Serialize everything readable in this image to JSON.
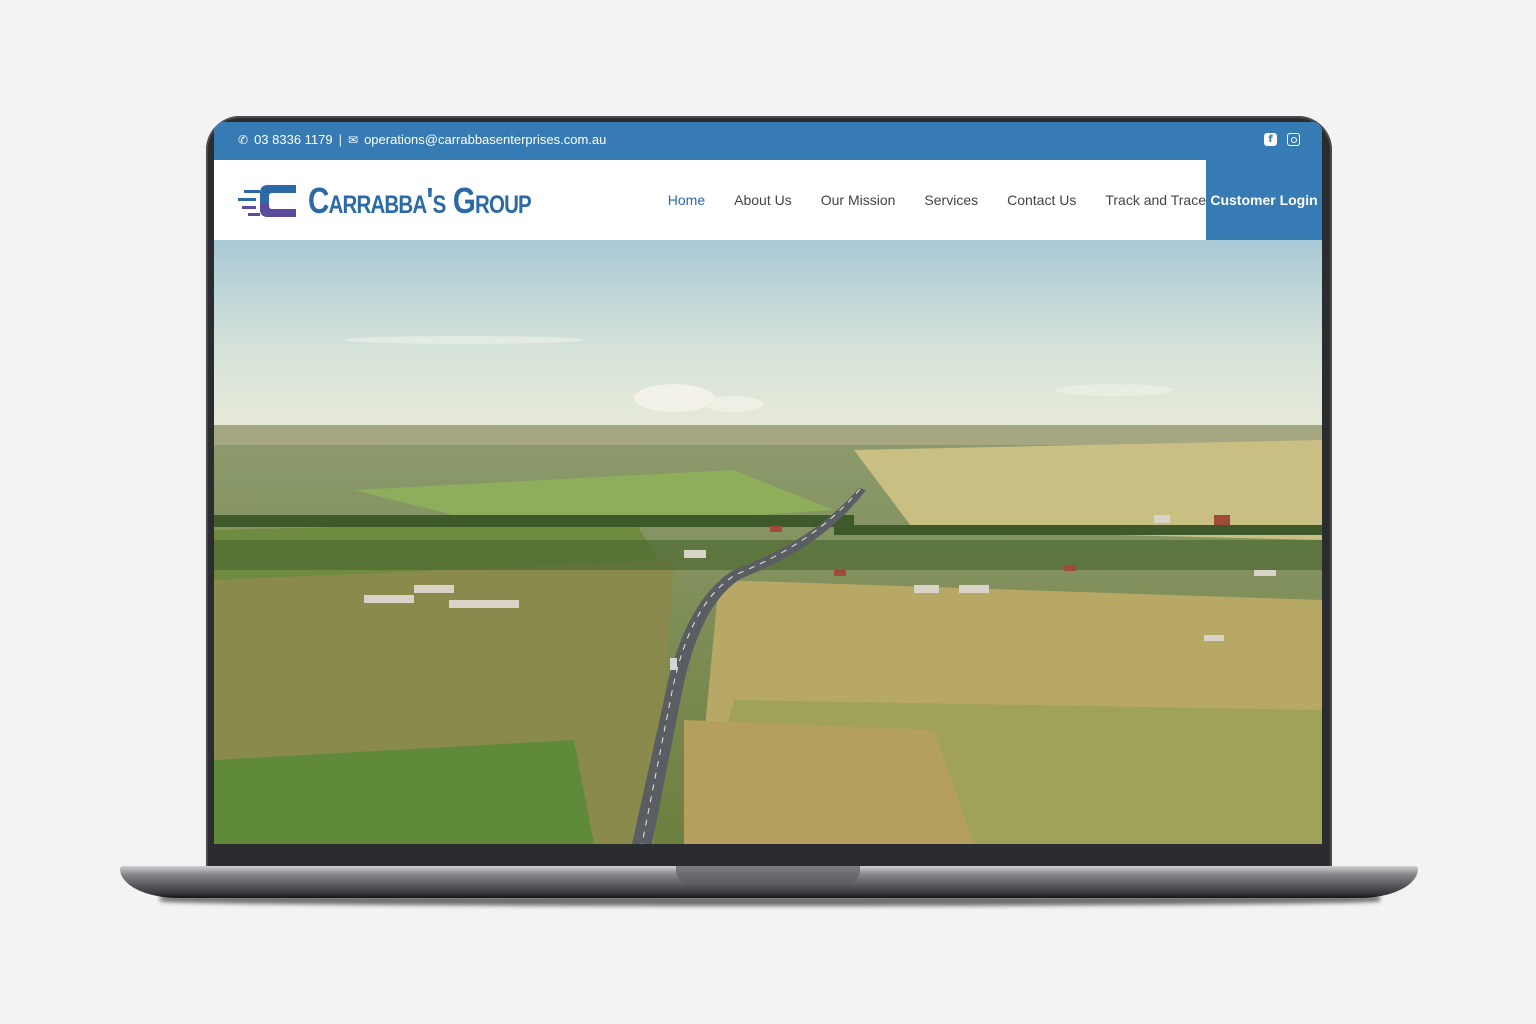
{
  "topbar": {
    "phone_icon": "phone-icon",
    "phone": "03 8336 1179",
    "separator": "|",
    "email_icon": "envelope-icon",
    "email": "operations@carrabbasenterprises.com.au",
    "social": [
      {
        "name": "facebook",
        "icon": "facebook-icon"
      },
      {
        "name": "instagram",
        "icon": "instagram-icon"
      }
    ]
  },
  "header": {
    "logo_text": "Carrabba's Group",
    "nav": [
      {
        "label": "Home",
        "active": true
      },
      {
        "label": "About Us",
        "active": false
      },
      {
        "label": "Our Mission",
        "active": false
      },
      {
        "label": "Services",
        "active": false
      },
      {
        "label": "Contact Us",
        "active": false
      },
      {
        "label": "Track and Trace",
        "active": false
      }
    ],
    "login_label": "Customer Login"
  },
  "colors": {
    "brand_blue": "#377bb4",
    "logo_blue": "#2b6aa6",
    "logo_purple": "#5b4a9e",
    "nav_text": "#444444"
  }
}
